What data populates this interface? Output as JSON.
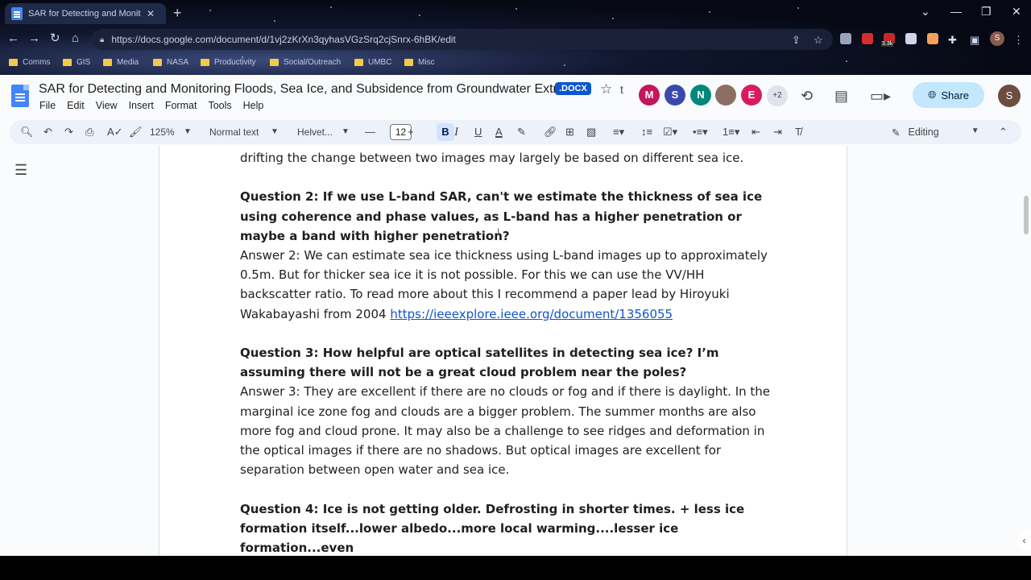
{
  "browser": {
    "tab_title": "SAR for Detecting and Monitoring",
    "tab_close": "✕",
    "new_tab": "+",
    "url": "https://docs.google.com/document/d/1vj2zKrXn3qyhasVGzSrq2cjSnrx-6hBK/edit",
    "profile_initial": "S",
    "extension_badge": "3.3k",
    "window_controls": [
      "⌄",
      "—",
      "❐",
      "✕"
    ],
    "bookmarks": [
      "Comms",
      "GIS",
      "Media",
      "NASA",
      "Productivity",
      "Social/Outreach",
      "UMBC",
      "Misc"
    ]
  },
  "doc": {
    "title": "SAR for Detecting and Monitoring Floods, Sea Ice, and Subsidence from Groundwater Extra...",
    "format_badge": ".DOCX",
    "menu": [
      "File",
      "Edit",
      "View",
      "Insert",
      "Format",
      "Tools",
      "Help"
    ],
    "collaborators": [
      {
        "initial": "M",
        "color": "#c2185b"
      },
      {
        "initial": "S",
        "color": "#3949ab"
      },
      {
        "initial": "N",
        "color": "#00897b"
      },
      {
        "initial": "",
        "color": "#8d6e63"
      },
      {
        "initial": "E",
        "color": "#d81b60"
      }
    ],
    "collaborators_more": "+2",
    "share_label": "Share",
    "user_initial": "S"
  },
  "toolbar": {
    "zoom": "125%",
    "style": "Normal text",
    "font": "Helvet...",
    "font_size": "12",
    "bold": "B",
    "italic": "I",
    "underline": "U",
    "text_color": "A",
    "mode": "Editing"
  },
  "content": {
    "line0": "drifting the change between two images may largely be based on different sea ice.",
    "q2": "Question 2: If we use L-band SAR, can't we estimate the thickness of sea ice using coherence and phase values, as L-band has a higher penetration or maybe a band with higher penetration?",
    "a2": "Answer 2: We can estimate sea ice thickness using L-band images up to approximately 0.5m. But for thicker sea ice it is not possible.  For this we can use the VV/HH backscatter ratio. To read more about this I recommend a paper lead by Hiroyuki Wakabayashi from 2004 ",
    "a2_link": "https://ieeexplore.ieee.org/document/1356055",
    "q3": "Question 3: How helpful are optical satellites in detecting sea ice? I’m assuming there will not be a great cloud problem near the poles?",
    "a3": "Answer 3: They are excellent if there are no clouds or fog and if there is daylight. In the marginal ice zone fog and clouds are a bigger problem. The summer months are also more fog and cloud prone. It may also be a challenge to see ridges and deformation in the optical images if there are no shadows. But optical images are excellent for separation between open water and sea ice.",
    "q4": "Question 4: Ice is not getting older. Defrosting in shorter times. + less ice formation itself...lower albedo...more local warming....lesser ice formation...even"
  }
}
